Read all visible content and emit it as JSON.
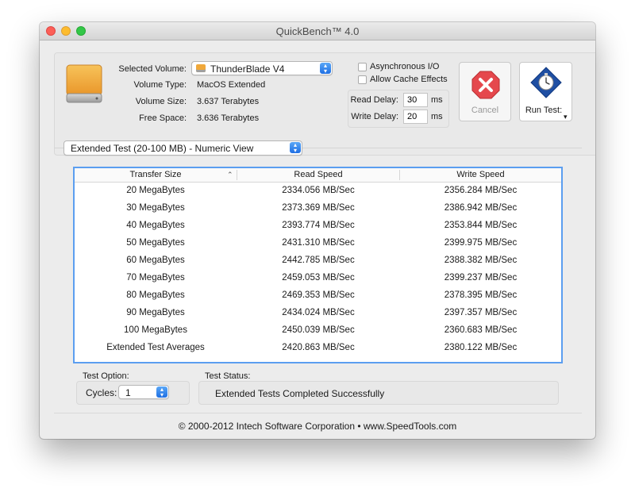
{
  "window": {
    "title": "QuickBench™ 4.0"
  },
  "volume": {
    "selected_label": "Selected Volume:",
    "selected_value": "ThunderBlade V4",
    "type_label": "Volume Type:",
    "type_value": "MacOS Extended",
    "size_label": "Volume Size:",
    "size_value": "3.637 Terabytes",
    "free_label": "Free Space:",
    "free_value": "3.636 Terabytes"
  },
  "options": {
    "async_label": "Asynchronous I/O",
    "cache_label": "Allow Cache Effects",
    "read_delay_label": "Read Delay:",
    "read_delay_value": "30",
    "read_delay_unit": "ms",
    "write_delay_label": "Write Delay:",
    "write_delay_value": "20",
    "write_delay_unit": "ms"
  },
  "buttons": {
    "cancel_label": "Cancel",
    "run_label": "Run Test:",
    "run_arrow": "▾"
  },
  "view_select": {
    "value": "Extended Test (20-100 MB) - Numeric View"
  },
  "table": {
    "headers": [
      "Transfer Size",
      "Read Speed",
      "Write Speed"
    ],
    "sort_indicator": "⌃",
    "rows": [
      [
        "20 MegaBytes",
        "2334.056 MB/Sec",
        "2356.284 MB/Sec"
      ],
      [
        "30 MegaBytes",
        "2373.369 MB/Sec",
        "2386.942 MB/Sec"
      ],
      [
        "40 MegaBytes",
        "2393.774 MB/Sec",
        "2353.844 MB/Sec"
      ],
      [
        "50 MegaBytes",
        "2431.310 MB/Sec",
        "2399.975 MB/Sec"
      ],
      [
        "60 MegaBytes",
        "2442.785 MB/Sec",
        "2388.382 MB/Sec"
      ],
      [
        "70 MegaBytes",
        "2459.053 MB/Sec",
        "2399.237 MB/Sec"
      ],
      [
        "80 MegaBytes",
        "2469.353 MB/Sec",
        "2378.395 MB/Sec"
      ],
      [
        "90 MegaBytes",
        "2434.024 MB/Sec",
        "2397.357 MB/Sec"
      ],
      [
        "100 MegaBytes",
        "2450.039 MB/Sec",
        "2360.683 MB/Sec"
      ],
      [
        "Extended Test Averages",
        "2420.863 MB/Sec",
        "2380.122 MB/Sec"
      ]
    ]
  },
  "test_option": {
    "label": "Test Option:",
    "cycles_label": "Cycles:",
    "cycles_value": "1"
  },
  "test_status": {
    "label": "Test Status:",
    "value": "Extended Tests Completed Successfully"
  },
  "footer": {
    "text": "© 2000-2012 Intech Software Corporation • www.SpeedTools.com"
  },
  "icons": {
    "drive": "hard-drive-icon",
    "cancel": "stop-x-icon",
    "run": "stopwatch-icon",
    "stepper": "up-down-stepper-icon"
  },
  "colors": {
    "accent": "#5b9ef0",
    "cancel_red": "#e5484d",
    "drive_orange": "#f2a93a"
  }
}
